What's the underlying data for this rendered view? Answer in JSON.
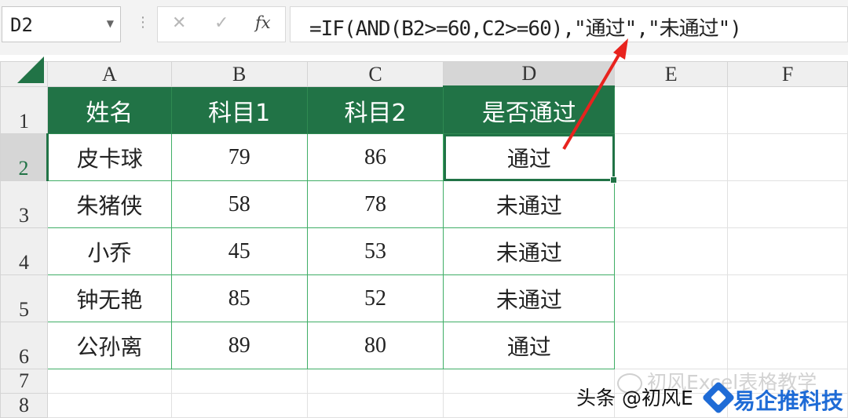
{
  "formula_bar": {
    "name_box": "D2",
    "cancel_glyph": "✕",
    "enter_glyph": "✓",
    "fx_label": "fx",
    "formula": "=IF(AND(B2>=60,C2>=60),\"通过\",\"未通过\")"
  },
  "columns": [
    "A",
    "B",
    "C",
    "D",
    "E",
    "F"
  ],
  "rows": [
    "1",
    "2",
    "3",
    "4",
    "5",
    "6",
    "7",
    "8"
  ],
  "table": {
    "headers": [
      "姓名",
      "科目1",
      "科目2",
      "是否通过"
    ],
    "rows": [
      [
        "皮卡球",
        "79",
        "86",
        "通过"
      ],
      [
        "朱猪侠",
        "58",
        "78",
        "未通过"
      ],
      [
        "小乔",
        "45",
        "53",
        "未通过"
      ],
      [
        "钟无艳",
        "85",
        "52",
        "未通过"
      ],
      [
        "公孙离",
        "89",
        "80",
        "通过"
      ]
    ]
  },
  "selection": {
    "active_cell": "D2"
  },
  "watermarks": {
    "channel": "初风Excel表格教学",
    "author": "头条 @初风E",
    "site": "易企推科技"
  },
  "colors": {
    "accent": "#217346",
    "annotation_arrow": "#e8231e",
    "site_logo": "#1e6bd6"
  },
  "icons": [
    "cancel-icon",
    "enter-icon",
    "function-icon",
    "dropdown-icon",
    "select-all-icon",
    "wechat-icon",
    "site-logo-icon"
  ]
}
